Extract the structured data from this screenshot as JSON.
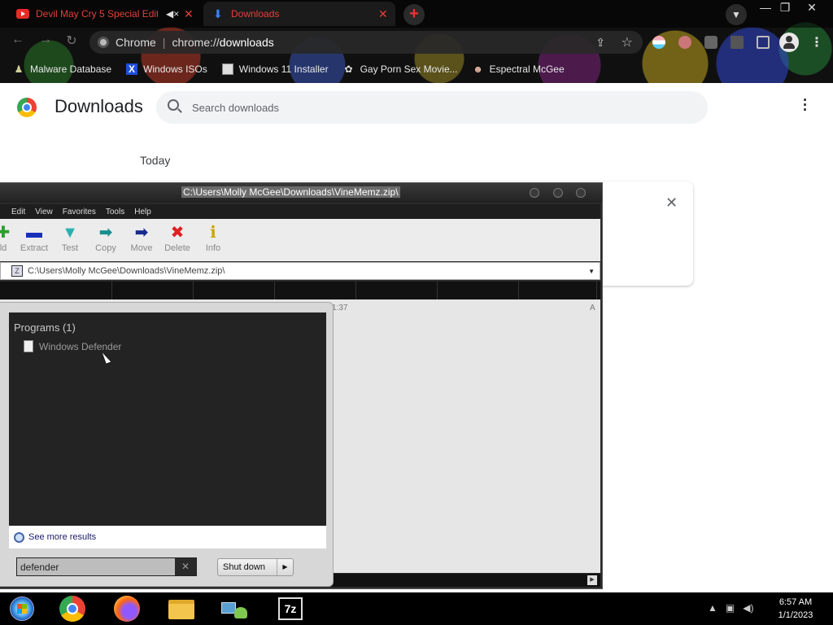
{
  "browser": {
    "tabs": [
      {
        "title": "Devil May Cry 5 Special Editi",
        "active": false
      },
      {
        "title": "Downloads",
        "active": true
      }
    ],
    "omnibox": {
      "site_label": "Chrome",
      "url_scheme": "chrome://",
      "url_host": "downloads"
    },
    "bookmarks": [
      {
        "label": "Malware Database",
        "icon": "person-icon"
      },
      {
        "label": "Windows ISOs",
        "icon": "x-icon"
      },
      {
        "label": "Windows 11 Installer",
        "icon": "page-icon"
      },
      {
        "label": "Gay Porn Sex Movie...",
        "icon": "gear-icon"
      },
      {
        "label": "Espectral McGee",
        "icon": "avatar-icon"
      }
    ]
  },
  "downloads_page": {
    "title": "Downloads",
    "search_placeholder": "Search downloads",
    "date_group": "Today"
  },
  "zip_window": {
    "title": "C:\\Users\\Molly McGee\\Downloads\\VineMemz.zip\\",
    "menu": [
      "Edit",
      "View",
      "Favorites",
      "Tools",
      "Help"
    ],
    "toolbar": [
      {
        "label": "ld",
        "icon": "add-icon",
        "color": "#2e9e2e"
      },
      {
        "label": "Extract",
        "icon": "extract-icon",
        "color": "#1a2fb8"
      },
      {
        "label": "Test",
        "icon": "test-icon",
        "color": "#2bb0b0"
      },
      {
        "label": "Copy",
        "icon": "copy-icon",
        "color": "#1a8f8f"
      },
      {
        "label": "Move",
        "icon": "move-icon",
        "color": "#1a2a8a"
      },
      {
        "label": "Delete",
        "icon": "delete-icon",
        "color": "#e02020"
      },
      {
        "label": "Info",
        "icon": "info-icon",
        "color": "#c9a800"
      }
    ],
    "path": "C:\\Users\\Molly McGee\\Downloads\\VineMemz.zip\\",
    "file_row": {
      "time_fragment": "1:37",
      "attr_fragment": "A"
    }
  },
  "start_menu": {
    "programs_heading": "Programs (1)",
    "result": "Windows Defender",
    "see_more": "See more results",
    "search_value": "defender",
    "shutdown_label": "Shut down"
  },
  "taskbar": {
    "apps": [
      "start-orb",
      "chrome",
      "firefox",
      "file-explorer",
      "network",
      "7-zip"
    ],
    "sevenzip_label": "7z",
    "time": "6:57 AM",
    "date": "1/1/2023"
  }
}
